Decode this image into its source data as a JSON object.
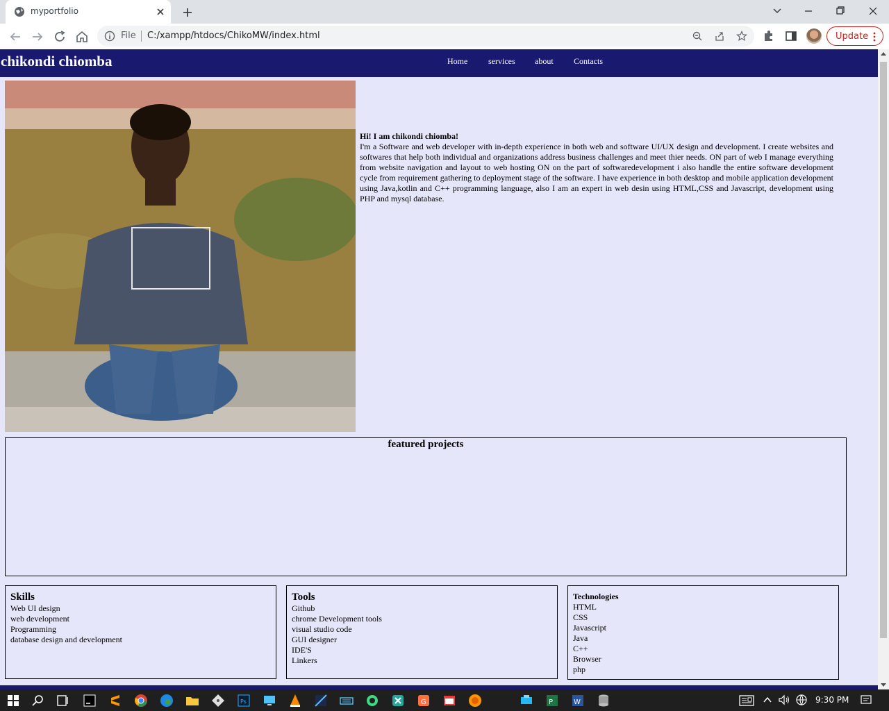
{
  "browser": {
    "tab_title": "myportfolio",
    "file_label": "File",
    "url": "C:/xampp/htdocs/ChikoMW/index.html",
    "update_label": "Update"
  },
  "site": {
    "brand": "chikondi chiomba",
    "nav": [
      "Home",
      "services",
      "about",
      "Contacts"
    ],
    "intro": {
      "greeting": "Hi! I am chikondi chiomba!",
      "text": "I'm a Software and web developer with in-depth experience in both web and software UI/UX design and development. I create websites and softwares that help both individual and organizations address business challenges and meet thier needs. ON part of web I manage everything from website navigation and layout to web hosting ON on the part of softwaredevelopment i also handle the entire software development cycle from requirement gathering to deployment stage of the software. I have experience in both desktop and mobile application development using Java,kotlin and C++ programming language, also I am an expert in web desin using HTML,CSS and Javascript, development using PHP and mysql database."
    },
    "featured_title": "featured projects",
    "skills": {
      "title": "Skills",
      "items": [
        "Web UI design",
        "web development",
        "Programming",
        "database design and development"
      ]
    },
    "tools": {
      "title": "Tools",
      "items": [
        "Github",
        "chrome Development tools",
        "visual studio code",
        "GUI designer",
        "IDE'S",
        "Linkers"
      ]
    },
    "technologies": {
      "title": "Technologies",
      "items": [
        "HTML",
        "CSS",
        "Javascript",
        "Java",
        "C++",
        "Browser",
        "php"
      ]
    }
  },
  "taskbar": {
    "time": "9:30 PM"
  },
  "colors": {
    "header_bg": "#191970",
    "page_bg": "#e6e6fa",
    "update_accent": "#c5221f"
  }
}
